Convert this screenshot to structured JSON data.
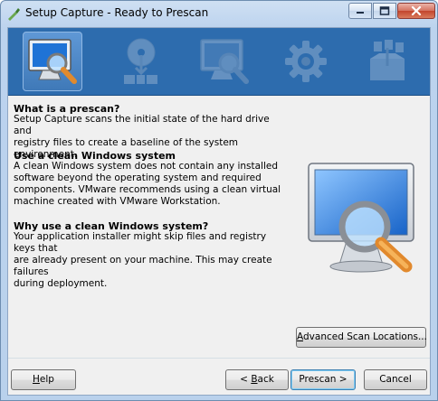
{
  "window": {
    "title": "Setup Capture - Ready to Prescan",
    "controls": {
      "minimize": "minimize-icon",
      "maximize": "maximize-icon",
      "close": "close-icon"
    }
  },
  "wizard_steps": [
    {
      "icon": "monitor-magnifier-icon",
      "active": true
    },
    {
      "icon": "disc-install-icon",
      "active": false
    },
    {
      "icon": "monitor-magnifier-icon",
      "active": false
    },
    {
      "icon": "gear-icon",
      "active": false
    },
    {
      "icon": "package-box-icon",
      "active": false
    }
  ],
  "sections": [
    {
      "heading": "What is a prescan?",
      "lines": [
        "Setup Capture scans the initial state of the hard drive and",
        "registry files to create a baseline of the system environment."
      ]
    },
    {
      "heading": "Use a clean Windows system",
      "lines": [
        "A clean Windows system does not contain any installed",
        "software beyond the operating system and required",
        "components. VMware recommends using a clean virtual",
        "machine created with VMware Workstation."
      ]
    },
    {
      "heading": "Why use a clean Windows system?",
      "lines": [
        "Your application installer might skip files and registry keys that",
        "are already present on your machine. This may create failures",
        "during deployment."
      ]
    }
  ],
  "buttons": {
    "advanced_prefix": "A",
    "advanced_rest": "dvanced Scan Locations...",
    "help_prefix": "H",
    "help_rest": "elp",
    "back_prefix": "< ",
    "back_u": "B",
    "back_rest": "ack",
    "prescan_label": "Prescan >",
    "cancel_label": "Cancel"
  },
  "colors": {
    "banner": "#2d6cae",
    "active_step": "#4f88c7",
    "dialog_bg": "#f0f0f0"
  }
}
